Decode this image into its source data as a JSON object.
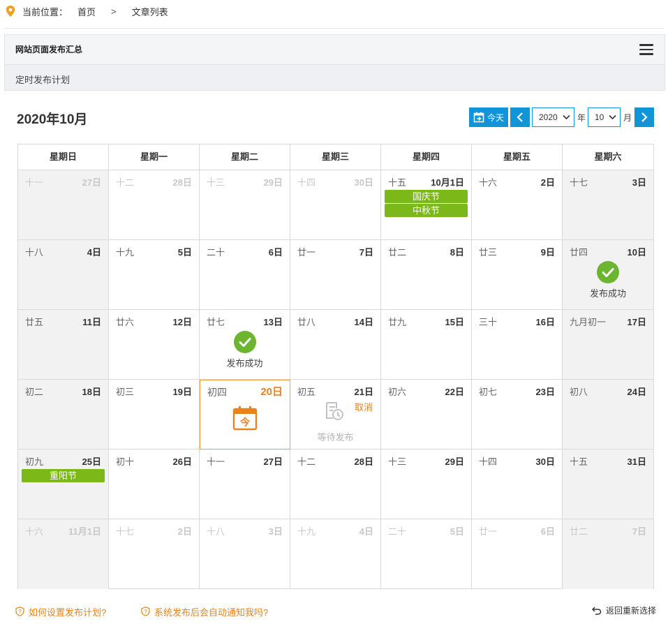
{
  "breadcrumb": {
    "label": "当前位置：",
    "home": "首页",
    "separator": ">",
    "current": "文章列表"
  },
  "panel": {
    "title": "网站页面发布汇总",
    "subtitle": "定时发布计划"
  },
  "calendar": {
    "title": "2020年10月",
    "today_label": "今天",
    "year_value": "2020",
    "year_unit": "年",
    "month_value": "10",
    "month_unit": "月",
    "weekdays": [
      "星期日",
      "星期一",
      "星期二",
      "星期三",
      "星期四",
      "星期五",
      "星期六"
    ],
    "weeks": [
      [
        {
          "lunar": "十一",
          "day": "27日",
          "other": true
        },
        {
          "lunar": "十二",
          "day": "28日",
          "other": true
        },
        {
          "lunar": "十三",
          "day": "29日",
          "other": true
        },
        {
          "lunar": "十四",
          "day": "30日",
          "other": true
        },
        {
          "lunar": "十五",
          "day": "10月1日",
          "festivals": [
            "国庆节",
            "中秋节"
          ]
        },
        {
          "lunar": "十六",
          "day": "2日"
        },
        {
          "lunar": "十七",
          "day": "3日"
        }
      ],
      [
        {
          "lunar": "十八",
          "day": "4日"
        },
        {
          "lunar": "十九",
          "day": "5日"
        },
        {
          "lunar": "二十",
          "day": "6日"
        },
        {
          "lunar": "廿一",
          "day": "7日"
        },
        {
          "lunar": "廿二",
          "day": "8日"
        },
        {
          "lunar": "廿三",
          "day": "9日"
        },
        {
          "lunar": "廿四",
          "day": "10日",
          "status": "发布成功"
        }
      ],
      [
        {
          "lunar": "廿五",
          "day": "11日"
        },
        {
          "lunar": "廿六",
          "day": "12日"
        },
        {
          "lunar": "廿七",
          "day": "13日",
          "status": "发布成功"
        },
        {
          "lunar": "廿八",
          "day": "14日"
        },
        {
          "lunar": "廿九",
          "day": "15日"
        },
        {
          "lunar": "三十",
          "day": "16日"
        },
        {
          "lunar": "九月初一",
          "day": "17日"
        }
      ],
      [
        {
          "lunar": "初二",
          "day": "18日"
        },
        {
          "lunar": "初三",
          "day": "19日"
        },
        {
          "lunar": "初四",
          "day": "20日",
          "today": true,
          "today_icon_text": "今"
        },
        {
          "lunar": "初五",
          "day": "21日",
          "pending": "等待发布",
          "cancel": "取消"
        },
        {
          "lunar": "初六",
          "day": "22日"
        },
        {
          "lunar": "初七",
          "day": "23日"
        },
        {
          "lunar": "初八",
          "day": "24日"
        }
      ],
      [
        {
          "lunar": "初九",
          "day": "25日",
          "festivals": [
            "重阳节"
          ]
        },
        {
          "lunar": "初十",
          "day": "26日"
        },
        {
          "lunar": "十一",
          "day": "27日"
        },
        {
          "lunar": "十二",
          "day": "28日"
        },
        {
          "lunar": "十三",
          "day": "29日"
        },
        {
          "lunar": "十四",
          "day": "30日"
        },
        {
          "lunar": "十五",
          "day": "31日"
        }
      ],
      [
        {
          "lunar": "十六",
          "day": "11月1日",
          "other": true
        },
        {
          "lunar": "十七",
          "day": "2日",
          "other": true
        },
        {
          "lunar": "十八",
          "day": "3日",
          "other": true
        },
        {
          "lunar": "十九",
          "day": "4日",
          "other": true
        },
        {
          "lunar": "二十",
          "day": "5日",
          "other": true
        },
        {
          "lunar": "廿一",
          "day": "6日",
          "other": true
        },
        {
          "lunar": "廿二",
          "day": "7日",
          "other": true
        }
      ]
    ]
  },
  "footer": {
    "help1": "如何设置发布计划?",
    "help2": "系统发布后会自动通知我吗?",
    "back": "返回重新选择"
  },
  "colors": {
    "accent": "#1295d8",
    "festival": "#7cb818",
    "success": "#6cb52f",
    "warning": "#e8821a"
  }
}
